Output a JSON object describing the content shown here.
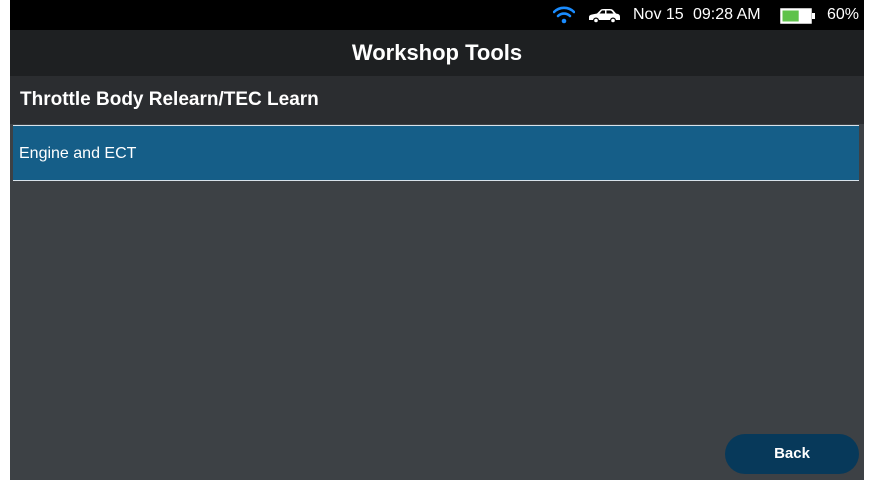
{
  "status_bar": {
    "date": "Nov 15",
    "time": "09:28 AM",
    "battery_percent": "60%",
    "battery_level": 0.6,
    "icons": [
      "wifi-icon",
      "car-icon",
      "battery-icon"
    ],
    "wifi_color": "#1a8cff",
    "battery_color": "#5ec24a"
  },
  "header": {
    "title": "Workshop Tools"
  },
  "sub_header": {
    "title": "Throttle Body Relearn/TEC Learn"
  },
  "list": {
    "items": [
      {
        "label": "Engine and ECT",
        "selected": true
      }
    ]
  },
  "footer": {
    "back_label": "Back"
  },
  "colors": {
    "background": "#3d4145",
    "title_bar": "#1e2022",
    "sub_header": "#2b2d30",
    "selected_item": "#155e88",
    "back_button": "#07395a"
  }
}
